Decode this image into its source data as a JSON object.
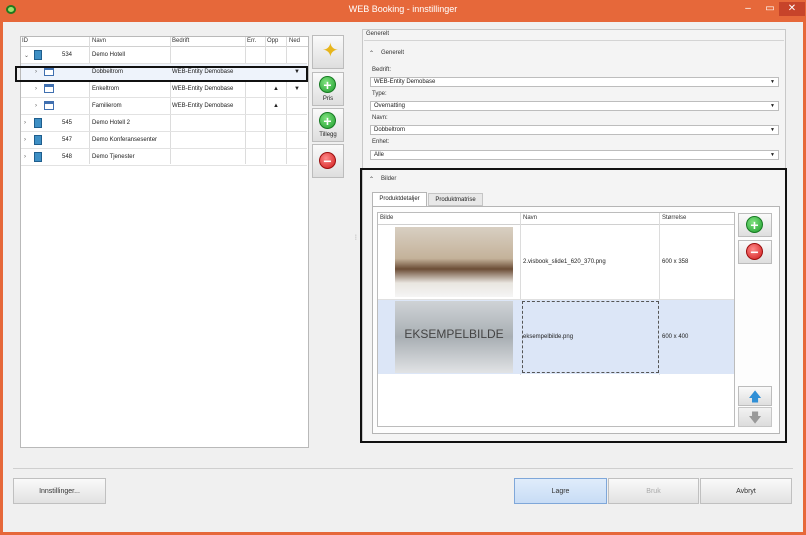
{
  "window": {
    "title": "WEB Booking - innstillinger",
    "minimize": "–",
    "restore": "▭",
    "close": "✕"
  },
  "tree": {
    "headers": {
      "id": "ID",
      "navn": "Navn",
      "bedrift": "Bedrift",
      "err": "Err.",
      "opp": "Opp",
      "ned": "Ned"
    },
    "rows": [
      {
        "expander": "⌄",
        "id": "534",
        "navn": "Demo Hotell",
        "bedrift": "",
        "opp": "",
        "ned": ""
      },
      {
        "expander": "›",
        "id": "",
        "navn": "Dobbeltrom",
        "bedrift": "WEB-Entity Demobase",
        "opp": "",
        "ned": "▼"
      },
      {
        "expander": "›",
        "id": "",
        "navn": "Enkeltrom",
        "bedrift": "WEB-Entity Demobase",
        "opp": "▲",
        "ned": "▼"
      },
      {
        "expander": "›",
        "id": "",
        "navn": "Familierom",
        "bedrift": "WEB-Entity Demobase",
        "opp": "▲",
        "ned": ""
      },
      {
        "expander": "›",
        "id": "545",
        "navn": "Demo Hotell 2",
        "bedrift": "",
        "opp": "",
        "ned": ""
      },
      {
        "expander": "›",
        "id": "547",
        "navn": "Demo Konferansesenter",
        "bedrift": "",
        "opp": "",
        "ned": ""
      },
      {
        "expander": "›",
        "id": "548",
        "navn": "Demo Tjenester",
        "bedrift": "",
        "opp": "",
        "ned": ""
      }
    ]
  },
  "side_buttons": {
    "pris": "Pris",
    "tillegg": "Tillegg"
  },
  "generelt": {
    "group_title": "Generelt",
    "section_title": "Generelt",
    "bedrift_label": "Bedrift:",
    "bedrift_value": "WEB-Entity Demobase",
    "type_label": "Type:",
    "type_value": "Overnatting",
    "navn_label": "Navn:",
    "navn_value": "Dobbeltrom",
    "enhet_label": "Enhet:",
    "enhet_value": "Alle"
  },
  "bilder": {
    "section_title": "Bilder",
    "tabs": [
      "Produktdetaljer",
      "Produktmatrise"
    ],
    "headers": {
      "bilde": "Bilde",
      "navn": "Navn",
      "storrelse": "Størrelse"
    },
    "rows": [
      {
        "navn": "2.visbook_slide1_620_370.png",
        "storrelse": "600 x 358",
        "placeholder": ""
      },
      {
        "navn": "eksempelbilde.png",
        "storrelse": "600 x 400",
        "placeholder": "EKSEMPELBILDE"
      }
    ]
  },
  "bottom": {
    "innstillinger": "Innstillinger...",
    "lagre": "Lagre",
    "bruk": "Bruk",
    "avbryt": "Avbryt"
  },
  "colors": {
    "titlebar": "#e6683a",
    "highlight_row": "#dce6f7",
    "lagre_button": "#cfe0f8"
  }
}
